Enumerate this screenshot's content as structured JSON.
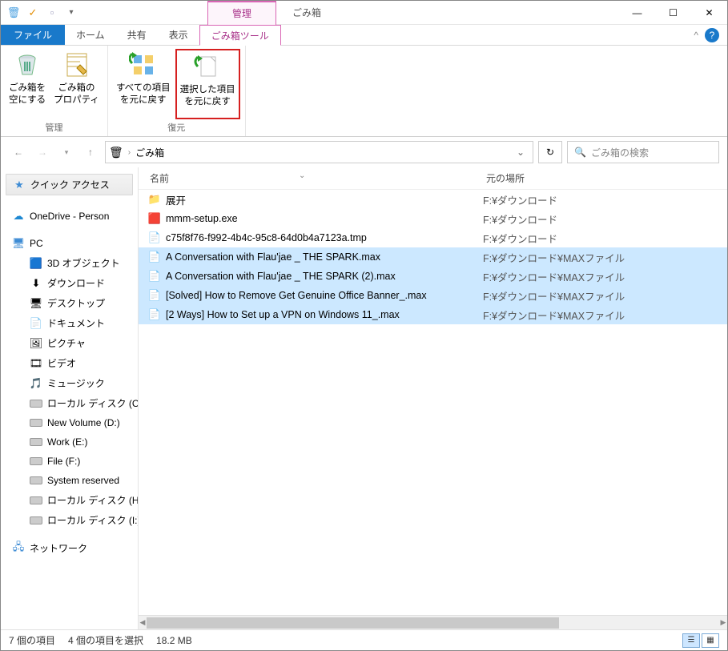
{
  "title": {
    "context_tab": "管理",
    "window_title": "ごみ箱"
  },
  "qat": {
    "icon1": "🗑",
    "icon2": "✓",
    "icon3": "▫",
    "dropdown": "⌄"
  },
  "ribbon_tabs": {
    "file": "ファイル",
    "home": "ホーム",
    "share": "共有",
    "view": "表示",
    "tools": "ごみ箱ツール",
    "collapse": "^"
  },
  "ribbon": {
    "group1": {
      "label": "管理",
      "empty": "ごみ箱を\n空にする",
      "props": "ごみ箱の\nプロパティ"
    },
    "group2": {
      "label": "復元",
      "restore_all": "すべての項目\nを元に戻す",
      "restore_sel": "選択した項目\nを元に戻す"
    }
  },
  "address": {
    "crumb": "ごみ箱",
    "search_placeholder": "ごみ箱の検索"
  },
  "sidebar": {
    "quick": "クイック アクセス",
    "onedrive": "OneDrive - Person",
    "pc": "PC",
    "pc_children": [
      {
        "icon": "🟦",
        "label": "3D オブジェクト"
      },
      {
        "icon": "⬇",
        "label": "ダウンロード"
      },
      {
        "icon": "🖥",
        "label": "デスクトップ"
      },
      {
        "icon": "📄",
        "label": "ドキュメント"
      },
      {
        "icon": "🖼",
        "label": "ピクチャ"
      },
      {
        "icon": "🎞",
        "label": "ビデオ"
      },
      {
        "icon": "🎵",
        "label": "ミュージック"
      },
      {
        "icon": "drive",
        "label": "ローカル ディスク (C"
      },
      {
        "icon": "drive",
        "label": "New Volume (D:)"
      },
      {
        "icon": "drive",
        "label": "Work (E:)"
      },
      {
        "icon": "drive",
        "label": "File (F:)"
      },
      {
        "icon": "drive",
        "label": "System reserved"
      },
      {
        "icon": "drive",
        "label": "ローカル ディスク (H"
      },
      {
        "icon": "drive",
        "label": "ローカル ディスク (I:)"
      }
    ],
    "network": "ネットワーク"
  },
  "columns": {
    "name": "名前",
    "location": "元の場所"
  },
  "files": [
    {
      "icon": "📁",
      "name": "展开",
      "loc": "F:¥ダウンロード",
      "selected": false
    },
    {
      "icon": "🟥",
      "name": "mmm-setup.exe",
      "loc": "F:¥ダウンロード",
      "selected": false
    },
    {
      "icon": "📄",
      "name": "c75f8f76-f992-4b4c-95c8-64d0b4a7123a.tmp",
      "loc": "F:¥ダウンロード",
      "selected": false
    },
    {
      "icon": "📄",
      "name": "A Conversation with Flau'jae _ THE SPARK.max",
      "loc": "F:¥ダウンロード¥MAXファイル",
      "selected": true
    },
    {
      "icon": "📄",
      "name": "A Conversation with Flau'jae _ THE SPARK (2).max",
      "loc": "F:¥ダウンロード¥MAXファイル",
      "selected": true
    },
    {
      "icon": "📄",
      "name": "[Solved] How to Remove Get Genuine Office Banner_.max",
      "loc": "F:¥ダウンロード¥MAXファイル",
      "selected": true
    },
    {
      "icon": "📄",
      "name": "[2 Ways] How to Set up a VPN on Windows 11_.max",
      "loc": "F:¥ダウンロード¥MAXファイル",
      "selected": true
    }
  ],
  "status": {
    "count": "7 個の項目",
    "selected": "4 個の項目を選択",
    "size": "18.2 MB"
  }
}
